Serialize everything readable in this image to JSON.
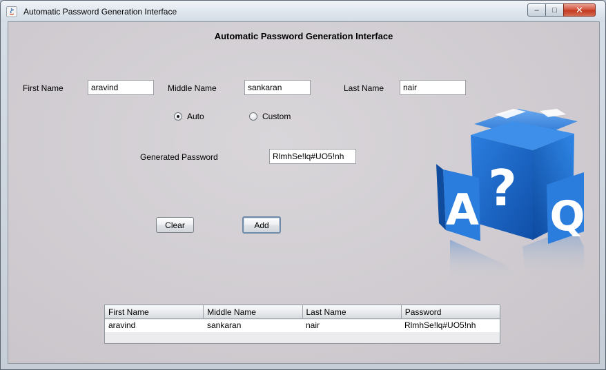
{
  "window": {
    "title": "Automatic Password Generation Interface",
    "controls": {
      "minimize": "–",
      "maximize": "□",
      "close": "✕"
    }
  },
  "form": {
    "heading": "Automatic Password Generation Interface",
    "first_name_label": "First Name",
    "first_name_value": "aravind",
    "middle_name_label": "Middle Name",
    "middle_name_value": "sankaran",
    "last_name_label": "Last Name",
    "last_name_value": "nair",
    "mode": {
      "auto_label": "Auto",
      "custom_label": "Custom",
      "selected": "Auto"
    },
    "generated_password_label": "Generated Password",
    "generated_password_value": "RlmhSe!lq#UO5!nh",
    "clear_label": "Clear",
    "add_label": "Add"
  },
  "graphic": {
    "icon": "question-mark-cube-icon",
    "letters": [
      "A",
      "?",
      "Q"
    ],
    "accent": "#1f6fd1"
  },
  "table": {
    "columns": [
      "First Name",
      "Middle Name",
      "Last Name",
      "Password"
    ],
    "rows": [
      [
        "aravind",
        "sankaran",
        "nair",
        "RlmhSe!lq#UO5!nh"
      ]
    ]
  }
}
